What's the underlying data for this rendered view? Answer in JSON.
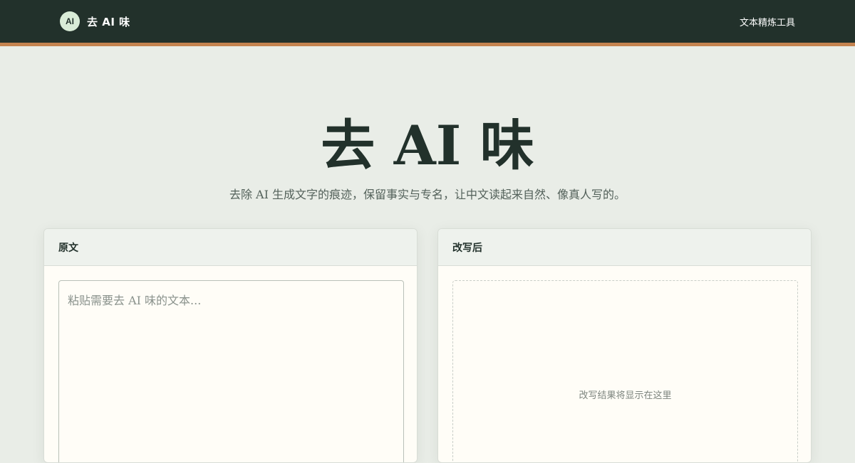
{
  "header": {
    "logo_text": "AI",
    "brand_name": "去 AI 味",
    "nav_link": "文本精炼工具",
    "colors": {
      "bar": "#22312b",
      "accent": "#c4834f"
    }
  },
  "hero": {
    "title": "去 AI 味",
    "subtitle": "去除 AI 生成文字的痕迹，保留事实与专名，让中文读起来自然、像真人写的。"
  },
  "source_panel": {
    "title": "原文",
    "input_value": "",
    "input_placeholder": "粘贴需要去 AI 味的文本..."
  },
  "result_panel": {
    "title": "改写后",
    "empty_text": "改写结果将显示在这里"
  }
}
